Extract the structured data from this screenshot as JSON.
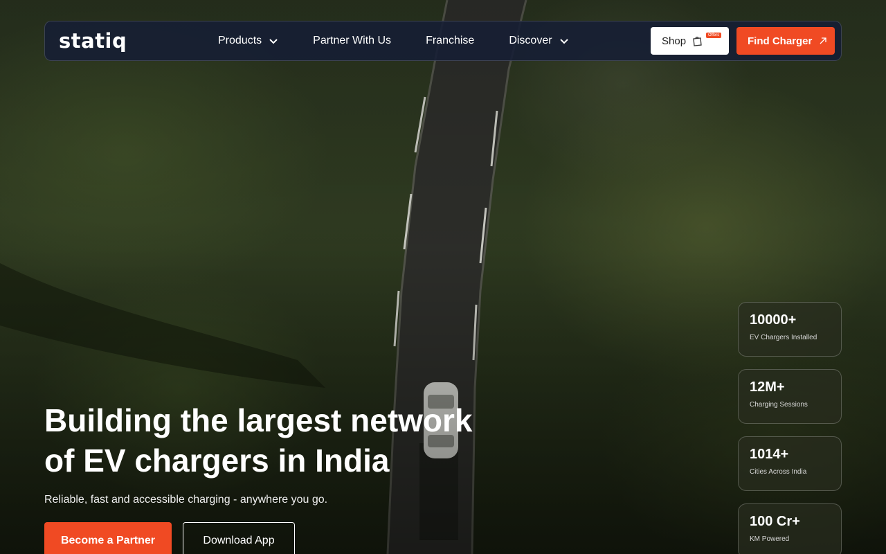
{
  "brand": {
    "logo_text": "statiq"
  },
  "nav": {
    "links": [
      {
        "label": "Products",
        "has_dropdown": true
      },
      {
        "label": "Partner With Us",
        "has_dropdown": false
      },
      {
        "label": "Franchise",
        "has_dropdown": false
      },
      {
        "label": "Discover",
        "has_dropdown": true
      }
    ],
    "shop": {
      "label": "Shop",
      "badge": "Offers",
      "icon": "shopping-bag-icon"
    },
    "find_charger": {
      "label": "Find Charger",
      "icon": "arrow-up-right-icon"
    }
  },
  "hero": {
    "headline_line1": "Building the largest network",
    "headline_line2": "of EV chargers in India",
    "subtitle": "Reliable, fast and accessible charging - anywhere you go.",
    "primary_cta": "Become a Partner",
    "secondary_cta": "Download App"
  },
  "stats": [
    {
      "value": "10000+",
      "label": "EV Chargers Installed"
    },
    {
      "value": "12M+",
      "label": "Charging Sessions"
    },
    {
      "value": "1014+",
      "label": "Cities Across India"
    },
    {
      "value": "100 Cr+",
      "label": "KM Powered"
    }
  ],
  "colors": {
    "accent": "#f04a23",
    "nav_bg": "#161e34",
    "text": "#ffffff"
  }
}
